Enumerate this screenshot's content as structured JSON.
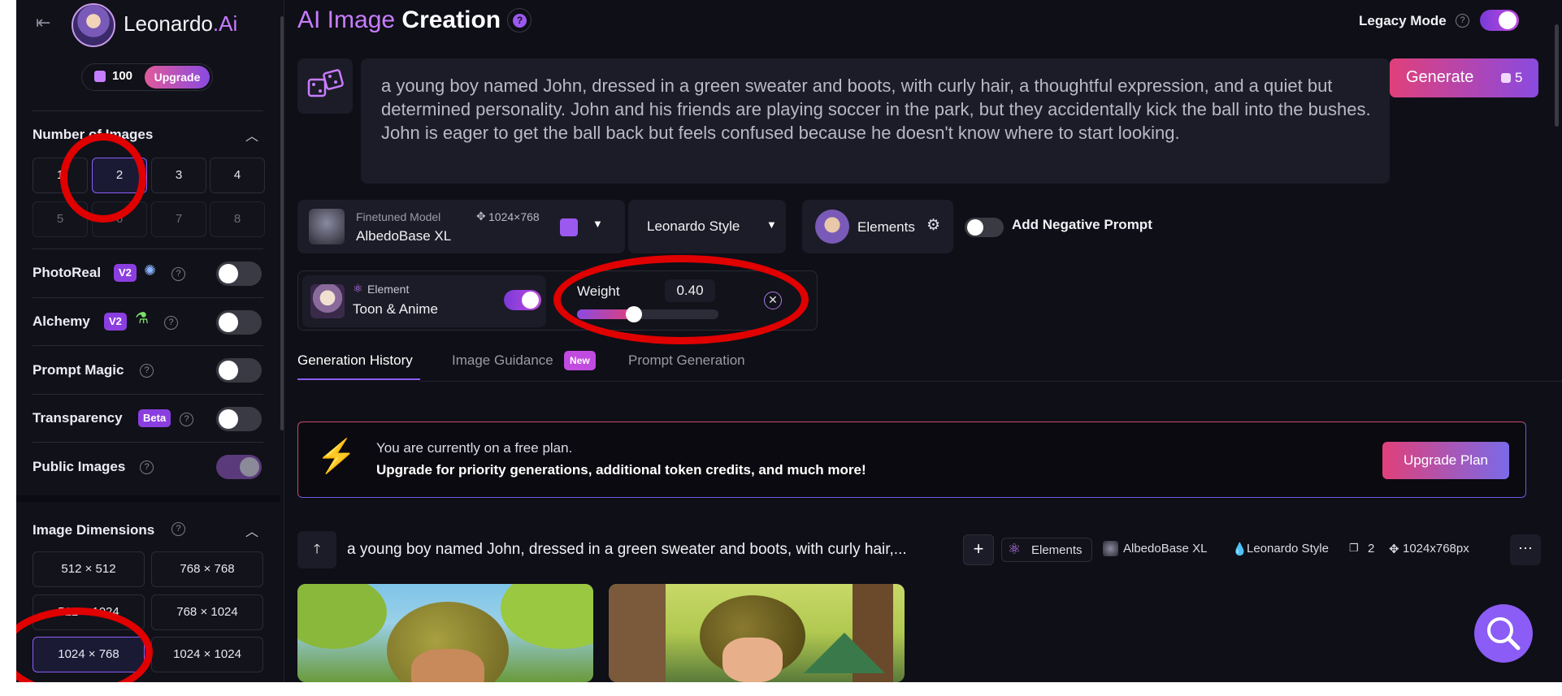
{
  "brand": {
    "name_main": "Leonardo",
    "name_suffix": ".Ai"
  },
  "tokens": {
    "count": "100",
    "upgrade_label": "Upgrade"
  },
  "sidebar": {
    "num_images_label": "Number of Images",
    "num_options": [
      "1",
      "2",
      "3",
      "4",
      "5",
      "6",
      "7",
      "8"
    ],
    "num_selected": "2",
    "photoreal_label": "PhotoReal",
    "photoreal_badge": "V2",
    "alchemy_label": "Alchemy",
    "alchemy_badge": "V2",
    "prompt_magic_label": "Prompt Magic",
    "transparency_label": "Transparency",
    "transparency_badge": "Beta",
    "public_images_label": "Public Images",
    "image_dimensions_label": "Image Dimensions",
    "dimension_options": [
      "512 × 512",
      "768 × 768",
      "512 × 1024",
      "768 × 1024",
      "1024 × 768",
      "1024 × 1024"
    ],
    "dimension_selected": "1024 × 768"
  },
  "header": {
    "title_accent": "AI Image",
    "title_rest": "Creation",
    "legacy_mode_label": "Legacy Mode",
    "legacy_mode_on": true
  },
  "prompt": {
    "text": "a young boy named John, dressed in a green sweater and boots, with curly hair, a thoughtful expression, and a quiet but determined personality. John and his friends are playing soccer in the park, but they accidentally kick the ball into the bushes. John is eager to get the ball back but feels confused because he doesn't know where to start looking.",
    "generate_label": "Generate",
    "generate_cost": "5"
  },
  "model": {
    "caption": "Finetuned Model",
    "name": "AlbedoBase XL",
    "size": "1024×768",
    "style_label": "Leonardo Style",
    "elements_label": "Elements",
    "negative_prompt_label": "Add Negative Prompt"
  },
  "element": {
    "caption": "Element",
    "name": "Toon & Anime",
    "enabled": true,
    "weight_label": "Weight",
    "weight_value": "0.40",
    "weight_fraction": 0.4
  },
  "tabs": [
    {
      "label": "Generation History",
      "active": true
    },
    {
      "label": "Image Guidance",
      "badge": "New"
    },
    {
      "label": "Prompt Generation"
    }
  ],
  "banner": {
    "line1": "You are currently on a free plan.",
    "line2": "Upgrade for priority generations, additional token credits, and much more!",
    "button": "Upgrade Plan"
  },
  "history": {
    "prompt_preview": "a young boy named John, dressed in a green sweater and boots, with curly hair,...",
    "elements_tag": "Elements",
    "model_tag": "AlbedoBase XL",
    "style_tag": "Leonardo Style",
    "count_tag": "2",
    "size_tag": "1024x768px"
  },
  "colors": {
    "accent_purple": "#8b5cf6",
    "gradient_pink": "#e0407a",
    "gradient_violet": "#8a4ae0",
    "annotation_red": "#e00000"
  }
}
